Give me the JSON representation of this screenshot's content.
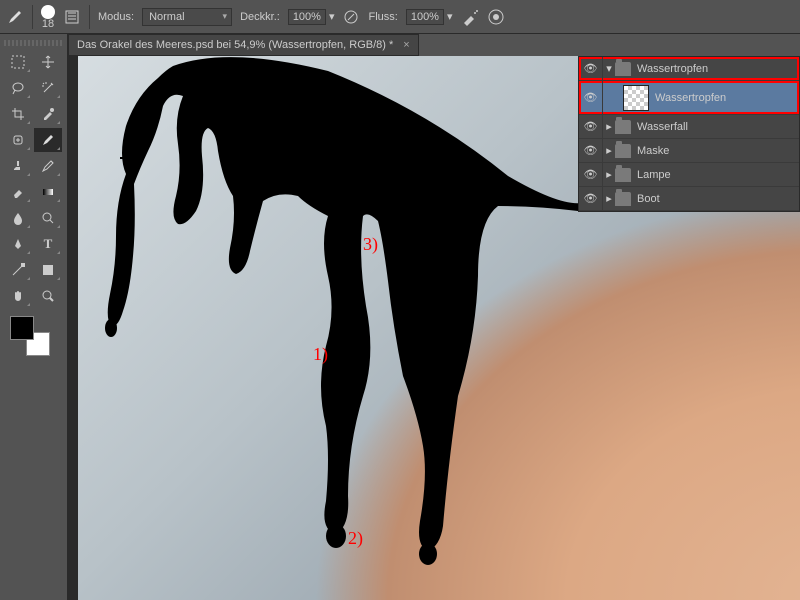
{
  "optionbar": {
    "brush_size": "18",
    "mode_label": "Modus:",
    "mode_value": "Normal",
    "opacity_label": "Deckkr.:",
    "opacity_value": "100%",
    "flow_label": "Fluss:",
    "flow_value": "100%"
  },
  "tab": {
    "title": "Das Orakel des Meeres.psd bei 54,9% (Wassertropfen, RGB/8) *"
  },
  "annotations": {
    "a1": "1)",
    "a2": "2)",
    "a3": "3)"
  },
  "layers": [
    {
      "kind": "group",
      "name": "Wassertropfen",
      "expanded": true,
      "highlight": true
    },
    {
      "kind": "layer",
      "name": "Wassertropfen",
      "selected": true,
      "highlight": true
    },
    {
      "kind": "group",
      "name": "Wasserfall",
      "expanded": false
    },
    {
      "kind": "group",
      "name": "Maske",
      "expanded": false
    },
    {
      "kind": "group",
      "name": "Lampe",
      "expanded": false
    },
    {
      "kind": "group",
      "name": "Boot",
      "expanded": false
    }
  ],
  "tool_icons": [
    "move",
    "marquee",
    "lasso",
    "wand",
    "crop",
    "eyedrop",
    "heal",
    "brush",
    "stamp",
    "history",
    "eraser",
    "gradient",
    "blur",
    "dodge",
    "pen",
    "type",
    "path",
    "shape",
    "hand",
    "zoom"
  ]
}
